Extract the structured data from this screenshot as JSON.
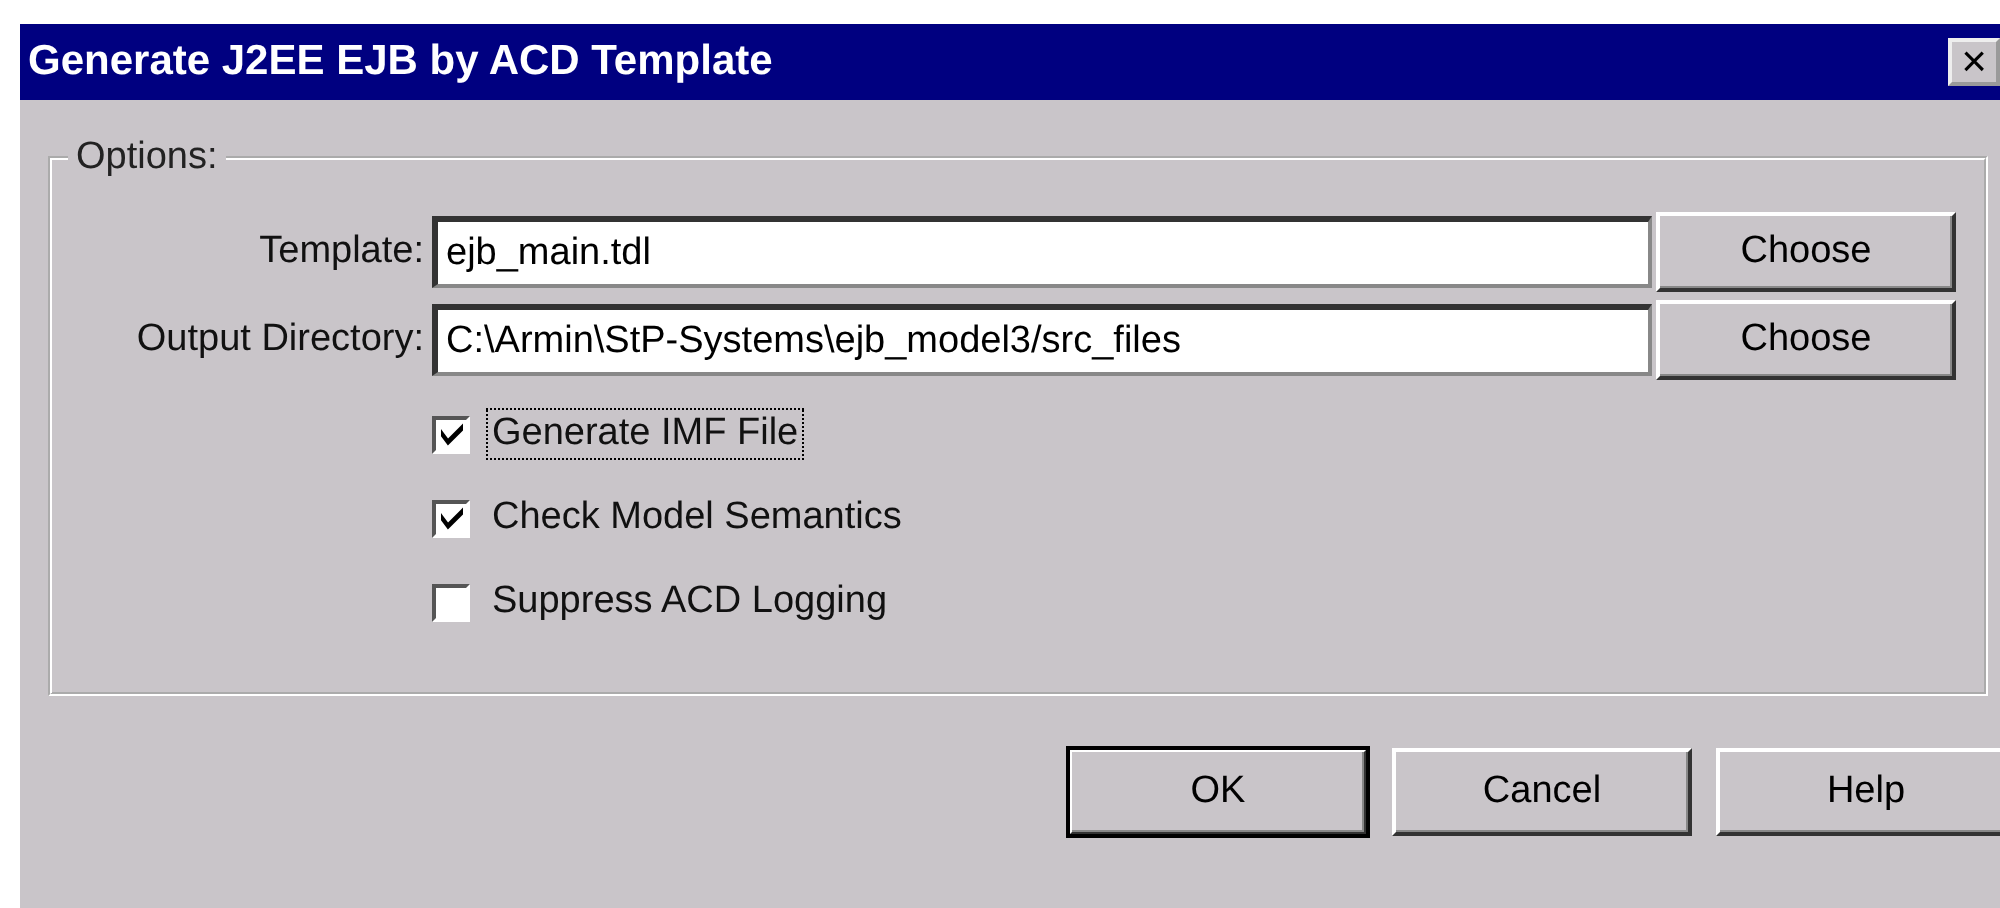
{
  "window": {
    "title": "Generate J2EE EJB by ACD Template",
    "close": "×"
  },
  "options": {
    "legend": "Options:",
    "fields": [
      {
        "label": "Template:",
        "value": "ejb_main.tdl",
        "button": "Choose"
      },
      {
        "label": "Output Directory:",
        "value": "C:\\Armin\\StP-Systems\\ejb_model3/src_files",
        "button": "Choose"
      }
    ],
    "checkboxes": [
      {
        "label": "Generate IMF File",
        "checked": true,
        "focused": true
      },
      {
        "label": "Check Model Semantics",
        "checked": true,
        "focused": false
      },
      {
        "label": "Suppress ACD Logging",
        "checked": false,
        "focused": false
      }
    ]
  },
  "buttons": [
    {
      "label": "OK",
      "default": true
    },
    {
      "label": "Cancel",
      "default": false
    },
    {
      "label": "Help",
      "default": false
    }
  ]
}
